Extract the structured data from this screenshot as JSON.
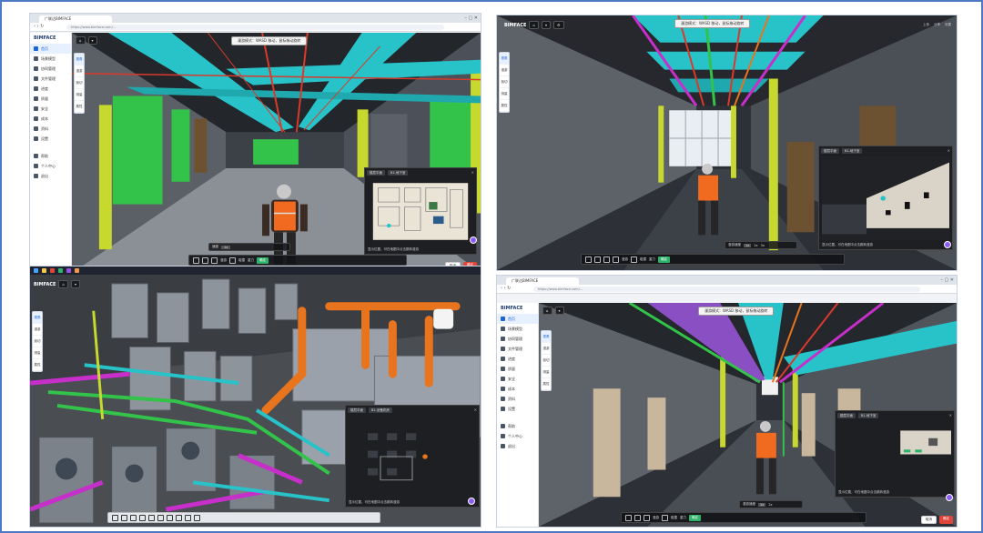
{
  "panels": {
    "p1": {
      "tab_title": "广联达BIMFACE",
      "address": "https://www.bimface.com/...",
      "sidebar_logo": "BIMFACE",
      "sidebar_items": [
        "首页",
        "场景模型",
        "协同管理",
        "文件管理",
        "进度",
        "质量",
        "安全",
        "成本",
        "资料",
        "设置",
        "帮助",
        "个人中心",
        "退出"
      ],
      "viewer_tip": "漫游模式：WASD 移动，鼠标拖动旋转",
      "left_tools": [
        "视角",
        "漫游",
        "剖切",
        "测量",
        "属性"
      ],
      "minimap_tabs": [
        "楼层平面",
        "B1-地下室"
      ],
      "minimap_foot": "显示位置，可在地图中点击跳转漫游",
      "bottom_items": [
        "漫游",
        "速度",
        "碰撞",
        "重力",
        "确定"
      ],
      "footer": {
        "cancel": "取消",
        "ok": "确定"
      }
    },
    "p2": {
      "logo": "BIMFACE",
      "viewer_tip": "漫游模式：WASD 移动，鼠标拖动旋转",
      "right_header": [
        "上传",
        "分享",
        "设置"
      ],
      "left_tools": [
        "视角",
        "漫游",
        "剖切",
        "测量",
        "属性"
      ],
      "minimap_tabs": [
        "楼层平面",
        "B1-地下室"
      ],
      "minimap_foot": "显示位置，可在地图中点击跳转漫游",
      "speed_items": [
        "漫游速度",
        "1x",
        "2x",
        "3x"
      ],
      "bottom_items": [
        "漫游",
        "碰撞",
        "重力",
        "确定"
      ]
    },
    "p3": {
      "logo": "BIMFACE",
      "left_tools": [
        "视角",
        "漫游",
        "剖切",
        "测量",
        "属性"
      ],
      "minimap_tabs": [
        "楼层平面",
        "B1-设备机房"
      ],
      "minimap_foot": "显示位置，可在地图中点击跳转漫游"
    },
    "p4": {
      "tab_title": "广联达BIMFACE",
      "address": "https://www.bimface.com/...",
      "sidebar_logo": "BIMFACE",
      "sidebar_items": [
        "首页",
        "场景模型",
        "协同管理",
        "文件管理",
        "进度",
        "质量",
        "安全",
        "成本",
        "资料",
        "设置",
        "帮助",
        "个人中心",
        "退出"
      ],
      "viewer_tip": "漫游模式：WASD 移动，鼠标拖动旋转",
      "left_tools": [
        "视角",
        "漫游",
        "剖切",
        "测量",
        "属性"
      ],
      "minimap_tabs": [
        "楼层平面",
        "B1-地下室"
      ],
      "minimap_foot": "显示位置，可在地图中点击跳转漫游",
      "speed_items": [
        "漫游速度",
        "1x",
        "2x"
      ],
      "bottom_items": [
        "漫游",
        "碰撞",
        "重力",
        "确定"
      ],
      "footer": {
        "cancel": "取消",
        "ok": "确定"
      }
    }
  },
  "colors": {
    "duct_cyan": "#27c3c9",
    "pipe_red": "#d93a2b",
    "pipe_orange": "#e8741e",
    "pipe_magenta": "#c62fc9",
    "wall_green": "#33c24a",
    "wall_yellow": "#c7d82f",
    "frame_blue": "#4f78c4",
    "vest_orange": "#f06a20"
  }
}
